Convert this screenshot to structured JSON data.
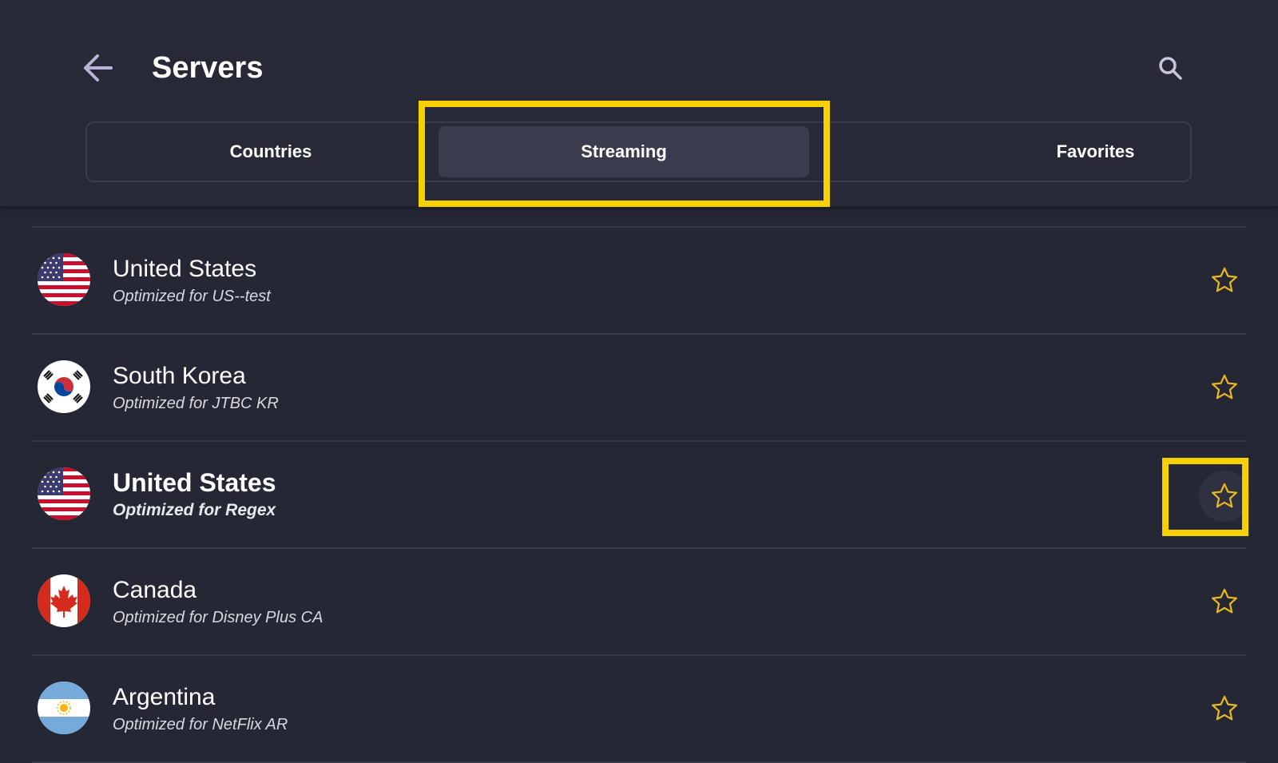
{
  "header": {
    "title": "Servers"
  },
  "tabs": [
    {
      "label": "Countries"
    },
    {
      "label": "Streaming"
    },
    {
      "label": "Favorites"
    }
  ],
  "colors": {
    "background": "#252734",
    "accent_highlight": "#f7d000",
    "star": "#e8b820",
    "selected_tab": "#3a3c4d"
  },
  "servers": [
    {
      "country": "United States",
      "subtitle": "Optimized for US--test",
      "flag": "us-flag-icon"
    },
    {
      "country": "South Korea",
      "subtitle": "Optimized for JTBC KR",
      "flag": "kr-flag-icon"
    },
    {
      "country": "United States",
      "subtitle": "Optimized for Regex",
      "flag": "us-flag-icon"
    },
    {
      "country": "Canada",
      "subtitle": "Optimized for Disney Plus CA",
      "flag": "ca-flag-icon"
    },
    {
      "country": "Argentina",
      "subtitle": "Optimized for NetFlix AR",
      "flag": "ar-flag-icon"
    }
  ]
}
